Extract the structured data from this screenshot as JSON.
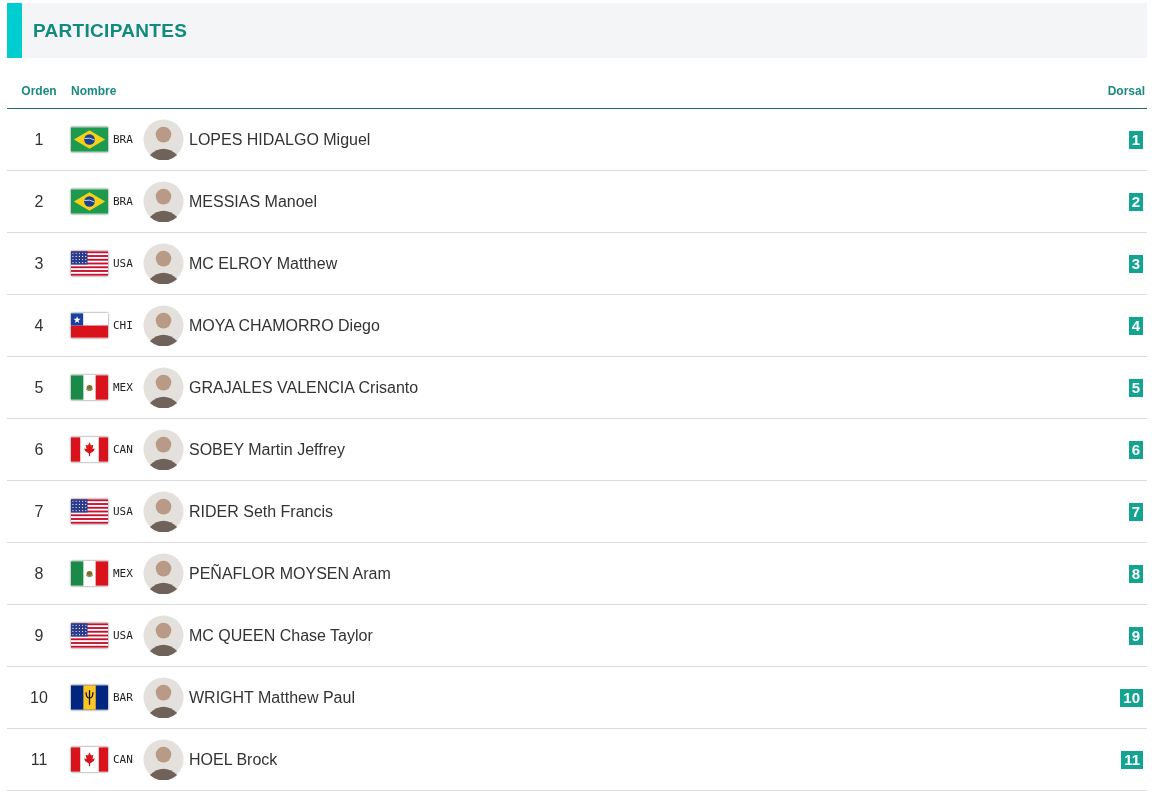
{
  "section": {
    "title": "PARTICIPANTES"
  },
  "table": {
    "columns": [
      "Orden",
      "Nombre",
      "Dorsal"
    ],
    "rows": [
      {
        "order": "1",
        "kind": "brazil",
        "country": "BRA",
        "name": "LOPES HIDALGO Miguel",
        "bib": "1"
      },
      {
        "order": "2",
        "kind": "brazil",
        "country": "BRA",
        "name": "MESSIAS Manoel",
        "bib": "2"
      },
      {
        "order": "3",
        "kind": "usa",
        "country": "USA",
        "name": "MC ELROY Matthew",
        "bib": "3"
      },
      {
        "order": "4",
        "kind": "chile",
        "country": "CHI",
        "name": "MOYA CHAMORRO Diego",
        "bib": "4"
      },
      {
        "order": "5",
        "kind": "mexico",
        "country": "MEX",
        "name": "GRAJALES VALENCIA Crisanto",
        "bib": "5"
      },
      {
        "order": "6",
        "kind": "canada",
        "country": "CAN",
        "name": "SOBEY Martin Jeffrey",
        "bib": "6"
      },
      {
        "order": "7",
        "kind": "usa",
        "country": "USA",
        "name": "RIDER Seth Francis",
        "bib": "7"
      },
      {
        "order": "8",
        "kind": "mexico",
        "country": "MEX",
        "name": "PEÑAFLOR MOYSEN Aram",
        "bib": "8"
      },
      {
        "order": "9",
        "kind": "usa",
        "country": "USA",
        "name": "MC QUEEN Chase Taylor",
        "bib": "9"
      },
      {
        "order": "10",
        "kind": "barbados",
        "country": "BAR",
        "name": "WRIGHT Matthew Paul",
        "bib": "10"
      },
      {
        "order": "11",
        "kind": "canada",
        "country": "CAN",
        "name": "HOEL Brock",
        "bib": "11"
      }
    ]
  }
}
